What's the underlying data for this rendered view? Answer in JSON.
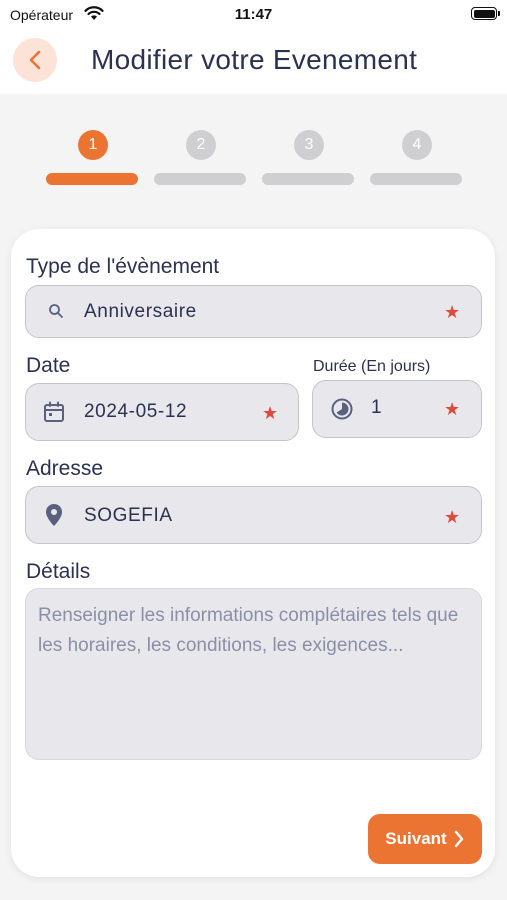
{
  "status_bar": {
    "carrier": "Opérateur",
    "time": "11:47"
  },
  "header": {
    "title": "Modifier votre Evenement"
  },
  "stepper": {
    "steps": [
      {
        "number": "1",
        "active": true
      },
      {
        "number": "2",
        "active": false
      },
      {
        "number": "3",
        "active": false
      },
      {
        "number": "4",
        "active": false
      }
    ]
  },
  "form": {
    "type": {
      "label": "Type de l'évènement",
      "value": "Anniversaire",
      "icon": "search-icon"
    },
    "date": {
      "label": "Date",
      "value": "2024-05-12",
      "icon": "calendar-icon"
    },
    "duration": {
      "label": "Durée (En jours)",
      "value": "1",
      "icon": "timer-icon"
    },
    "address": {
      "label": "Adresse",
      "value": "SOGEFIA",
      "icon": "location-pin-icon"
    },
    "details": {
      "label": "Détails",
      "placeholder": "Renseigner les informations complétaires tels que les horaires, les conditions, les exigences..."
    },
    "required_marker": "★",
    "next_label": "Suivant"
  },
  "colors": {
    "accent": "#ec7432",
    "accent_light": "#fde3d7",
    "required": "#e04a3a",
    "text": "#2b3150",
    "inactive": "#cfcfd2"
  }
}
